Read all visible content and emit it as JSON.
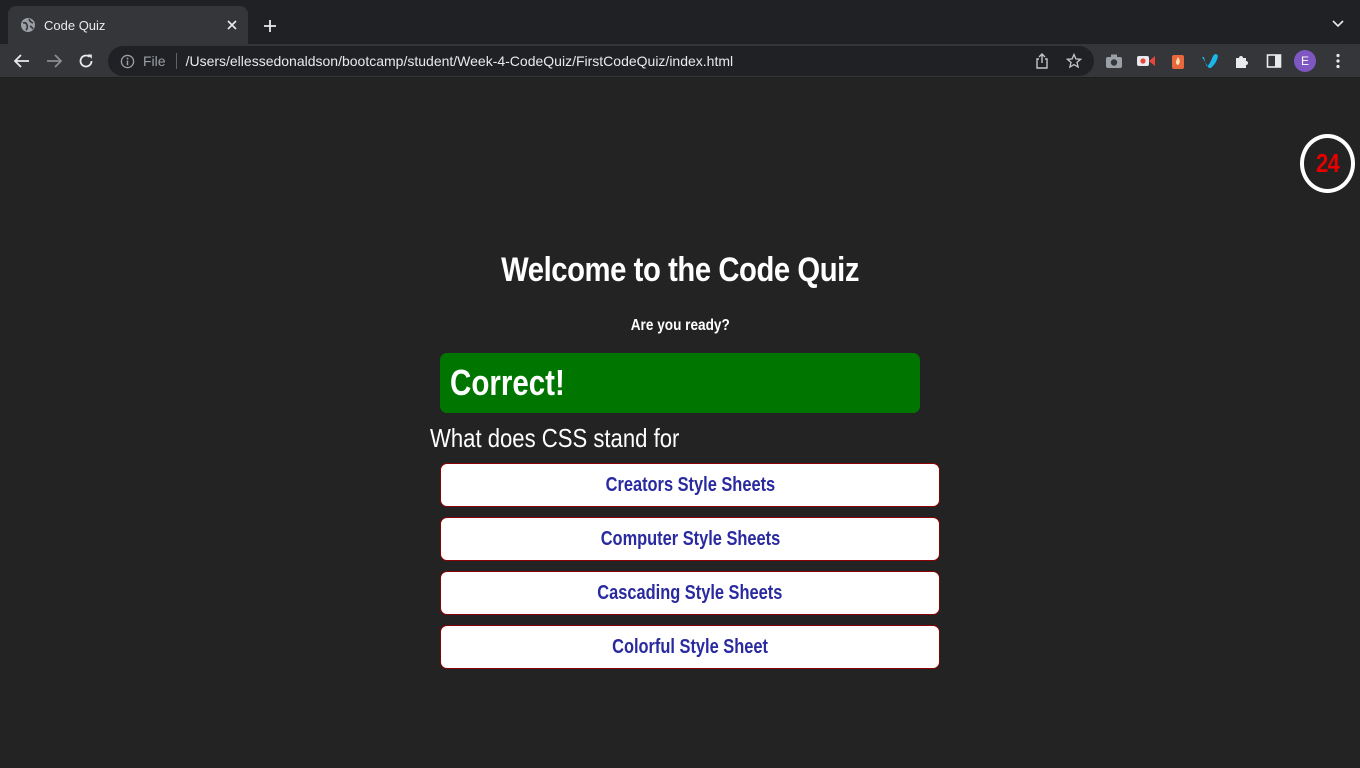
{
  "browser": {
    "tab_title": "Code Quiz",
    "address_scheme_label": "File",
    "url": "/Users/ellessedonaldson/bootcamp/student/Week-4-CodeQuiz/FirstCodeQuiz/index.html",
    "profile_initial": "E"
  },
  "quiz": {
    "timer": "24",
    "title": "Welcome to the Code Quiz",
    "subtitle": "Are you ready?",
    "feedback": "Correct!",
    "question": "What does CSS stand for",
    "answers": [
      "Creators Style Sheets",
      "Computer Style Sheets",
      "Cascading Style Sheets",
      "Colorful Style Sheet"
    ]
  },
  "colors": {
    "page_background": "#232323",
    "feedback_correct": "#007600",
    "timer_text": "#e60000",
    "answer_text": "#2a2aa0",
    "answer_border": "#8b0000"
  }
}
